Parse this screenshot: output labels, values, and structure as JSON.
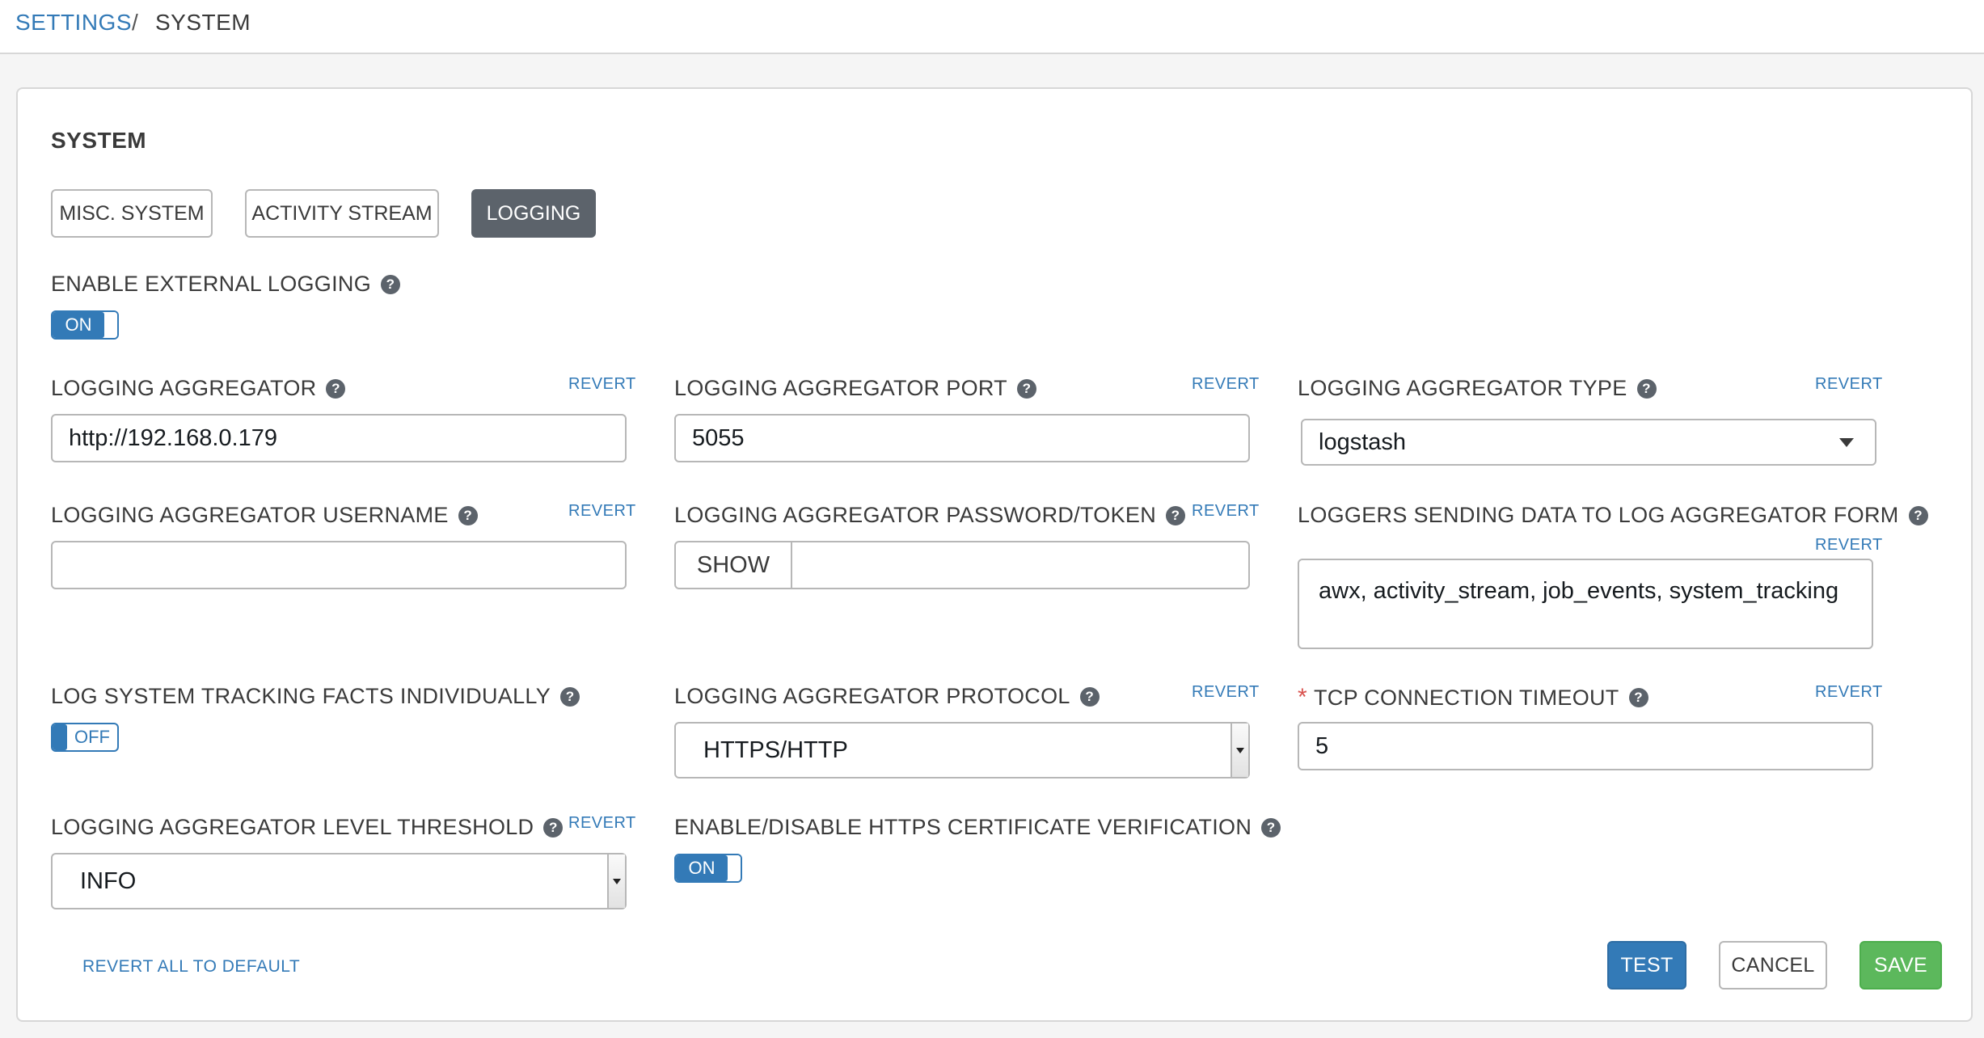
{
  "breadcrumb": {
    "settings": "SETTINGS",
    "separator": "/",
    "current": "SYSTEM"
  },
  "panel": {
    "title": "SYSTEM"
  },
  "tabs": [
    {
      "label": "MISC. SYSTEM",
      "active": false
    },
    {
      "label": "ACTIVITY STREAM",
      "active": false
    },
    {
      "label": "LOGGING",
      "active": true
    }
  ],
  "help_glyph": "?",
  "revert_label": "REVERT",
  "fields": {
    "enable_external_logging": {
      "label": "ENABLE EXTERNAL LOGGING",
      "toggle": "ON"
    },
    "logging_aggregator": {
      "label": "LOGGING AGGREGATOR",
      "value": "http://192.168.0.179"
    },
    "logging_aggregator_port": {
      "label": "LOGGING AGGREGATOR PORT",
      "value": "5055"
    },
    "logging_aggregator_type": {
      "label": "LOGGING AGGREGATOR TYPE",
      "value": "logstash"
    },
    "logging_aggregator_username": {
      "label": "LOGGING AGGREGATOR USERNAME",
      "value": ""
    },
    "logging_aggregator_password": {
      "label": "LOGGING AGGREGATOR PASSWORD/TOKEN",
      "show_label": "SHOW",
      "value": ""
    },
    "loggers_sending_data": {
      "label": "LOGGERS SENDING DATA TO LOG AGGREGATOR FORM",
      "value": "awx, activity_stream, job_events, system_tracking"
    },
    "log_system_tracking": {
      "label": "LOG SYSTEM TRACKING FACTS INDIVIDUALLY",
      "toggle": "OFF"
    },
    "logging_aggregator_protocol": {
      "label": "LOGGING AGGREGATOR PROTOCOL",
      "value": "HTTPS/HTTP"
    },
    "tcp_connection_timeout": {
      "label": "TCP CONNECTION TIMEOUT",
      "required_mark": "*",
      "value": "5"
    },
    "logging_aggregator_level_threshold": {
      "label": "LOGGING AGGREGATOR LEVEL THRESHOLD",
      "value": "INFO"
    },
    "https_cert_verification": {
      "label": "ENABLE/DISABLE HTTPS CERTIFICATE VERIFICATION",
      "toggle": "ON"
    }
  },
  "footer": {
    "revert_all": "REVERT ALL TO DEFAULT",
    "test": "TEST",
    "cancel": "CANCEL",
    "save": "SAVE"
  },
  "colors": {
    "link": "#337ab7",
    "save": "#5cb85c",
    "active_tab": "#5c636b",
    "required": "#d9534f"
  }
}
